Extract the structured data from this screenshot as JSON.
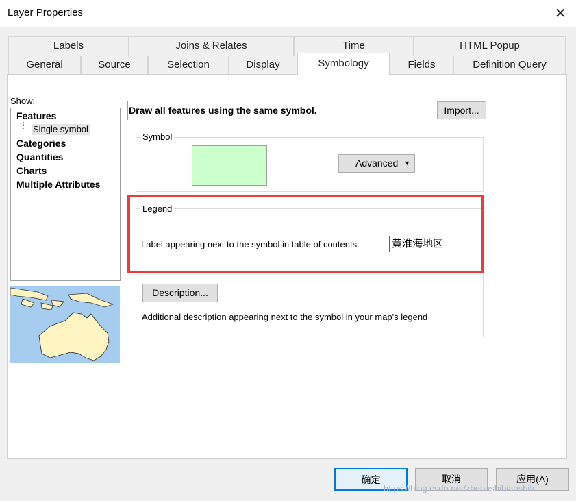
{
  "window": {
    "title": "Layer Properties"
  },
  "tabs": {
    "row1": [
      "Labels",
      "Joins & Relates",
      "Time",
      "HTML Popup"
    ],
    "row2": [
      "General",
      "Source",
      "Selection",
      "Display",
      "Symbology",
      "Fields",
      "Definition Query"
    ],
    "active": "Symbology"
  },
  "show": {
    "label": "Show:",
    "items": [
      "Features",
      "Single symbol",
      "Categories",
      "Quantities",
      "Charts",
      "Multiple Attributes"
    ],
    "selected": "Single symbol"
  },
  "symbology": {
    "heading": "Draw all features using the same symbol.",
    "import_button": "Import...",
    "symbol_group": "Symbol",
    "symbol_color": "#ccffcc",
    "advanced_button": "Advanced",
    "legend_group": "Legend",
    "legend_label": "Label appearing next to the symbol in table of contents:",
    "legend_value": "黄淮海地区",
    "description_button": "Description...",
    "description_text": "Additional description appearing next to the symbol in your map's legend"
  },
  "footer": {
    "ok": "确定",
    "cancel": "取消",
    "apply": "应用(A)",
    "watermark": "https://blog.csdn.net/zhebushibiaoshifu"
  },
  "colors": {
    "highlight": "#ee3b3b",
    "map_water": "#a6ccef",
    "map_land": "#fff5c2"
  }
}
